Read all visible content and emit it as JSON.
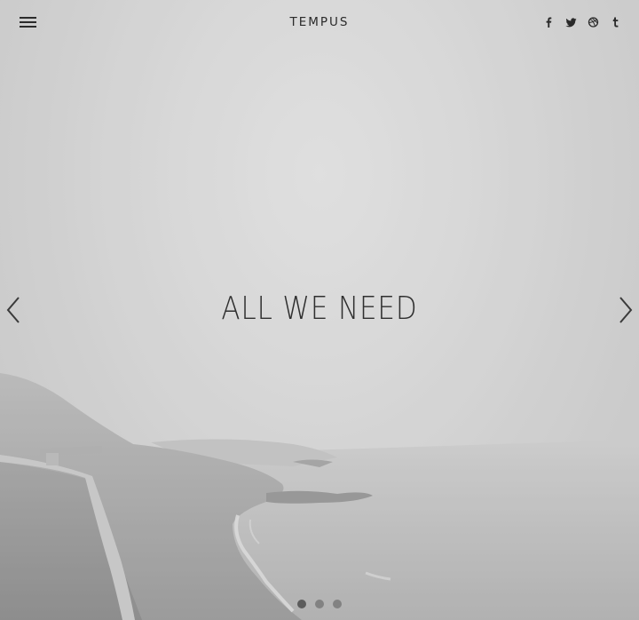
{
  "header": {
    "brand": "TEMPUS",
    "menu_icon": "hamburger-menu-icon",
    "social": [
      {
        "name": "facebook",
        "icon": "facebook-icon"
      },
      {
        "name": "twitter",
        "icon": "twitter-icon"
      },
      {
        "name": "dribbble",
        "icon": "dribbble-icon"
      },
      {
        "name": "tumblr",
        "icon": "tumblr-icon"
      }
    ]
  },
  "slider": {
    "headline": "ALL WE NEED",
    "prev_icon": "chevron-left-icon",
    "next_icon": "chevron-right-icon",
    "slide_count": 3,
    "active_slide": 1
  },
  "colors": {
    "text": "#2f2f2f",
    "dot_active": "#5c5c5c",
    "dot_inactive": "#828282"
  }
}
